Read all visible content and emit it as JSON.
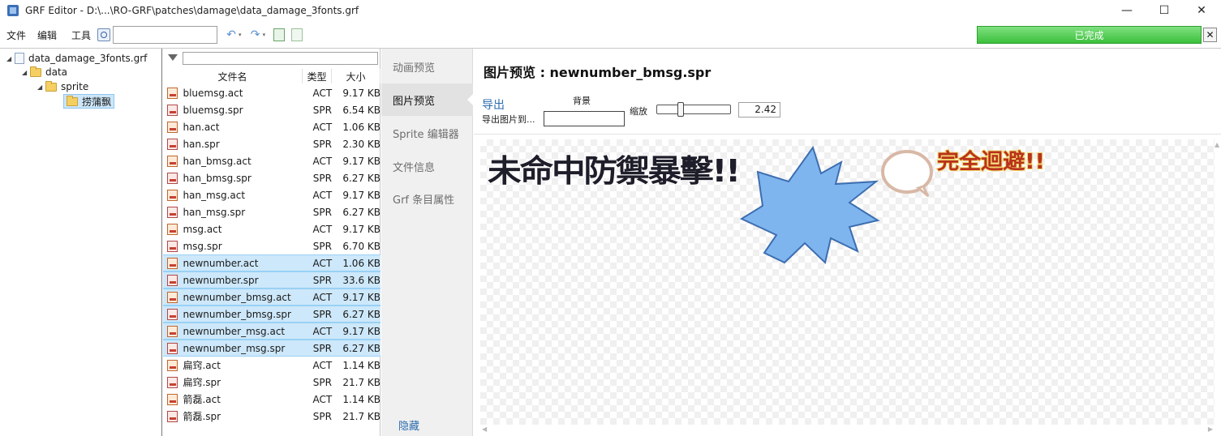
{
  "window": {
    "title": "GRF Editor - D:\\...\\RO-GRF\\patches\\damage\\data_damage_3fonts.grf",
    "minimize": "—",
    "maximize": "☐",
    "close": "✕"
  },
  "menu": {
    "file": "文件",
    "edit": "编辑",
    "tools": "工具",
    "search_value": ""
  },
  "toolbar": {
    "undo": "↶",
    "redo": "↷",
    "dropdown": "▾"
  },
  "progress": {
    "label": "已完成",
    "close": "✕",
    "color": "#3cc03c"
  },
  "tree": {
    "root": "data_damage_3fonts.grf",
    "data": "data",
    "sprite": "sprite",
    "selected": "捞蒲飘",
    "arrow": "◢"
  },
  "file_list": {
    "filter_value": "",
    "headers": {
      "name": "文件名",
      "type": "类型",
      "size": "大小"
    },
    "files": [
      {
        "name": "bluemsg.act",
        "type": "ACT",
        "size": "9.17 KB"
      },
      {
        "name": "bluemsg.spr",
        "type": "SPR",
        "size": "6.54 KB"
      },
      {
        "name": "han.act",
        "type": "ACT",
        "size": "1.06 KB"
      },
      {
        "name": "han.spr",
        "type": "SPR",
        "size": "2.30 KB"
      },
      {
        "name": "han_bmsg.act",
        "type": "ACT",
        "size": "9.17 KB"
      },
      {
        "name": "han_bmsg.spr",
        "type": "SPR",
        "size": "6.27 KB"
      },
      {
        "name": "han_msg.act",
        "type": "ACT",
        "size": "9.17 KB"
      },
      {
        "name": "han_msg.spr",
        "type": "SPR",
        "size": "6.27 KB"
      },
      {
        "name": "msg.act",
        "type": "ACT",
        "size": "9.17 KB"
      },
      {
        "name": "msg.spr",
        "type": "SPR",
        "size": "6.70 KB"
      },
      {
        "name": "newnumber.act",
        "type": "ACT",
        "size": "1.06 KB",
        "selected": true
      },
      {
        "name": "newnumber.spr",
        "type": "SPR",
        "size": "33.6 KB",
        "selected": true
      },
      {
        "name": "newnumber_bmsg.act",
        "type": "ACT",
        "size": "9.17 KB",
        "selected": true
      },
      {
        "name": "newnumber_bmsg.spr",
        "type": "SPR",
        "size": "6.27 KB",
        "selected": true
      },
      {
        "name": "newnumber_msg.act",
        "type": "ACT",
        "size": "9.17 KB",
        "selected": true
      },
      {
        "name": "newnumber_msg.spr",
        "type": "SPR",
        "size": "6.27 KB",
        "selected": true
      },
      {
        "name": "扁窍.act",
        "type": "ACT",
        "size": "1.14 KB"
      },
      {
        "name": "扁窍.spr",
        "type": "SPR",
        "size": "21.7 KB"
      },
      {
        "name": "箭磊.act",
        "type": "ACT",
        "size": "1.14 KB"
      },
      {
        "name": "箭磊.spr",
        "type": "SPR",
        "size": "21.7 KB"
      }
    ]
  },
  "tabs": [
    {
      "label": "动画预览"
    },
    {
      "label": "图片预览",
      "active": true
    },
    {
      "label": "Sprite 编辑器"
    },
    {
      "label": "文件信息"
    },
    {
      "label": "Grf 条目属性"
    }
  ],
  "hide_label": "隐藏",
  "preview": {
    "title": "图片预览 : newnumber_bmsg.spr",
    "export": "导出",
    "export_to": "导出图片到...",
    "background_label": "背景",
    "zoom_label": "缩放",
    "zoom_value": "2.42",
    "zoom_fraction": 0.3,
    "sprite_text_left": "未命中防禦暴擊!!",
    "sprite_text_right": "完全迴避!!",
    "starburst_color": "#7fb5ef",
    "bubble_color": "#d8b8a6"
  }
}
